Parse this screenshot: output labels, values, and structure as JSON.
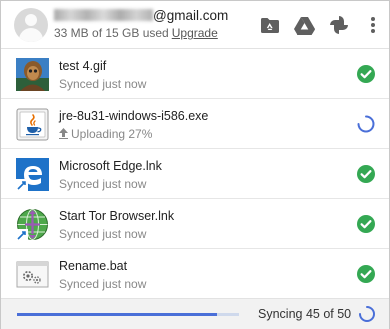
{
  "account": {
    "email_suffix": "@gmail.com",
    "usage_text": "33 MB of 15 GB used",
    "upgrade_label": "Upgrade"
  },
  "header_icons": [
    "open-drive-folder-icon",
    "google-drive-icon",
    "google-photos-icon",
    "more-vert-icon"
  ],
  "files": [
    {
      "name": "test 4.gif",
      "status": "Synced just now",
      "icon": "gif-thumbnail",
      "state": "synced"
    },
    {
      "name": "jre-8u31-windows-i586.exe",
      "status": "Uploading 27%",
      "icon": "java-icon",
      "state": "uploading"
    },
    {
      "name": "Microsoft Edge.lnk",
      "status": "Synced just now",
      "icon": "edge-icon",
      "state": "synced"
    },
    {
      "name": "Start Tor Browser.lnk",
      "status": "Synced just now",
      "icon": "tor-icon",
      "state": "synced"
    },
    {
      "name": "Rename.bat",
      "status": "Synced just now",
      "icon": "batch-file-icon",
      "state": "synced"
    }
  ],
  "sync": {
    "label": "Syncing 45 of 50",
    "progress_fraction": 0.9
  },
  "colors": {
    "accent": "#4a6fd8",
    "synced_green": "#34a853",
    "icon_gray": "#5f5f5f"
  }
}
